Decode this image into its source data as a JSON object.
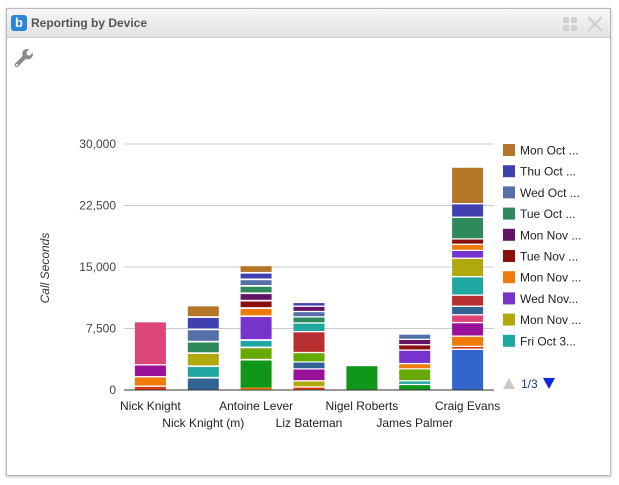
{
  "window": {
    "title": "Reporting by Device",
    "logo_letter": "b"
  },
  "icons": {
    "logo": "bria-logo-icon",
    "layout": "grid-icon",
    "close": "close-icon",
    "settings": "wrench-icon"
  },
  "legend_pager": {
    "text": "1/3",
    "prev": "pager-up-icon",
    "next": "pager-down-icon"
  },
  "chart_data": {
    "type": "bar",
    "stacked": true,
    "ylabel": "Call Seconds",
    "ylim": [
      0,
      30000
    ],
    "yticks": [
      "0",
      "7,500",
      "15,000",
      "22,500",
      "30,000"
    ],
    "ytick_values": [
      0,
      7500,
      15000,
      22500,
      30000
    ],
    "grid": true,
    "legend_position": "right",
    "categories": [
      "Nick Knight",
      "Nick Knight (m)",
      "Antoine Lever",
      "Liz Bateman",
      "Nigel Roberts",
      "James Palmer",
      "Craig Evans"
    ],
    "legend": [
      {
        "label": "Mon Oct ...",
        "color": "#b5762a"
      },
      {
        "label": "Thu Oct ...",
        "color": "#4040b0"
      },
      {
        "label": "Wed Oct ...",
        "color": "#5570a8"
      },
      {
        "label": "Tue Oct ...",
        "color": "#2e8a5c"
      },
      {
        "label": "Mon Nov ...",
        "color": "#641466"
      },
      {
        "label": "Tue Nov ...",
        "color": "#8a1010"
      },
      {
        "label": "Mon Nov ...",
        "color": "#f07a0a"
      },
      {
        "label": "Wed Nov...",
        "color": "#7733cc"
      },
      {
        "label": "Mon Nov ...",
        "color": "#b0a80c"
      },
      {
        "label": "Fri Oct 3...",
        "color": "#20a6a0"
      }
    ],
    "stacks": [
      [
        {
          "v": 400,
          "c": "#dc3912"
        },
        {
          "v": 150,
          "c": "#ffffff"
        },
        {
          "v": 1000,
          "c": "#f07a0a"
        },
        {
          "v": 150,
          "c": "#ffffff"
        },
        {
          "v": 1300,
          "c": "#991199"
        },
        {
          "v": 150,
          "c": "#ffffff"
        },
        {
          "v": 5100,
          "c": "#dd4477"
        }
      ],
      [
        {
          "v": 1400,
          "c": "#316395"
        },
        {
          "v": 200,
          "c": "#ffffff"
        },
        {
          "v": 1200,
          "c": "#20a6a0"
        },
        {
          "v": 200,
          "c": "#ffffff"
        },
        {
          "v": 1400,
          "c": "#b0a80c"
        },
        {
          "v": 200,
          "c": "#ffffff"
        },
        {
          "v": 1200,
          "c": "#2e8a5c"
        },
        {
          "v": 200,
          "c": "#ffffff"
        },
        {
          "v": 1300,
          "c": "#5570a8"
        },
        {
          "v": 200,
          "c": "#ffffff"
        },
        {
          "v": 1300,
          "c": "#4040b0"
        },
        {
          "v": 200,
          "c": "#ffffff"
        },
        {
          "v": 1200,
          "c": "#b5762a"
        }
      ],
      [
        {
          "v": 300,
          "c": "#f07a0a"
        },
        {
          "v": 3300,
          "c": "#109618"
        },
        {
          "v": 200,
          "c": "#ffffff"
        },
        {
          "v": 1300,
          "c": "#66aa00"
        },
        {
          "v": 200,
          "c": "#ffffff"
        },
        {
          "v": 700,
          "c": "#20a6a0"
        },
        {
          "v": 200,
          "c": "#ffffff"
        },
        {
          "v": 2700,
          "c": "#7733cc"
        },
        {
          "v": 200,
          "c": "#ffffff"
        },
        {
          "v": 800,
          "c": "#f07a0a"
        },
        {
          "v": 200,
          "c": "#ffffff"
        },
        {
          "v": 700,
          "c": "#8a1010"
        },
        {
          "v": 200,
          "c": "#ffffff"
        },
        {
          "v": 700,
          "c": "#641466"
        },
        {
          "v": 200,
          "c": "#ffffff"
        },
        {
          "v": 700,
          "c": "#2e8a5c"
        },
        {
          "v": 200,
          "c": "#ffffff"
        },
        {
          "v": 600,
          "c": "#5570a8"
        },
        {
          "v": 200,
          "c": "#ffffff"
        },
        {
          "v": 600,
          "c": "#4040b0"
        },
        {
          "v": 200,
          "c": "#ffffff"
        },
        {
          "v": 700,
          "c": "#b5762a"
        }
      ],
      [
        {
          "v": 300,
          "c": "#dc3912"
        },
        {
          "v": 150,
          "c": "#ffffff"
        },
        {
          "v": 600,
          "c": "#b0a80c"
        },
        {
          "v": 150,
          "c": "#ffffff"
        },
        {
          "v": 1300,
          "c": "#991199"
        },
        {
          "v": 150,
          "c": "#ffffff"
        },
        {
          "v": 700,
          "c": "#316395"
        },
        {
          "v": 150,
          "c": "#ffffff"
        },
        {
          "v": 1000,
          "c": "#66aa00"
        },
        {
          "v": 150,
          "c": "#ffffff"
        },
        {
          "v": 2400,
          "c": "#b82e2e"
        },
        {
          "v": 150,
          "c": "#ffffff"
        },
        {
          "v": 900,
          "c": "#20a6a0"
        },
        {
          "v": 150,
          "c": "#ffffff"
        },
        {
          "v": 600,
          "c": "#2e8a5c"
        },
        {
          "v": 150,
          "c": "#ffffff"
        },
        {
          "v": 500,
          "c": "#5570a8"
        },
        {
          "v": 150,
          "c": "#ffffff"
        },
        {
          "v": 500,
          "c": "#641466"
        },
        {
          "v": 150,
          "c": "#ffffff"
        },
        {
          "v": 300,
          "c": "#4040b0"
        }
      ],
      [
        {
          "v": 2900,
          "c": "#109618"
        }
      ],
      [
        {
          "v": 600,
          "c": "#109618"
        },
        {
          "v": 150,
          "c": "#ffffff"
        },
        {
          "v": 300,
          "c": "#20a6a0"
        },
        {
          "v": 150,
          "c": "#ffffff"
        },
        {
          "v": 1300,
          "c": "#66aa00"
        },
        {
          "v": 150,
          "c": "#ffffff"
        },
        {
          "v": 500,
          "c": "#f07a0a"
        },
        {
          "v": 150,
          "c": "#ffffff"
        },
        {
          "v": 1500,
          "c": "#7733cc"
        },
        {
          "v": 150,
          "c": "#ffffff"
        },
        {
          "v": 500,
          "c": "#8a1010"
        },
        {
          "v": 150,
          "c": "#ffffff"
        },
        {
          "v": 500,
          "c": "#641466"
        },
        {
          "v": 150,
          "c": "#ffffff"
        },
        {
          "v": 500,
          "c": "#5570a8"
        }
      ],
      [
        {
          "v": 4900,
          "c": "#3366cc"
        },
        {
          "v": 150,
          "c": "#ffffff"
        },
        {
          "v": 200,
          "c": "#dc3912"
        },
        {
          "v": 150,
          "c": "#ffffff"
        },
        {
          "v": 1100,
          "c": "#f07a0a"
        },
        {
          "v": 150,
          "c": "#ffffff"
        },
        {
          "v": 1500,
          "c": "#991199"
        },
        {
          "v": 150,
          "c": "#ffffff"
        },
        {
          "v": 800,
          "c": "#dd4477"
        },
        {
          "v": 150,
          "c": "#ffffff"
        },
        {
          "v": 900,
          "c": "#316395"
        },
        {
          "v": 150,
          "c": "#ffffff"
        },
        {
          "v": 1200,
          "c": "#b82e2e"
        },
        {
          "v": 150,
          "c": "#ffffff"
        },
        {
          "v": 2100,
          "c": "#20a6a0"
        },
        {
          "v": 150,
          "c": "#ffffff"
        },
        {
          "v": 2100,
          "c": "#b0a80c"
        },
        {
          "v": 150,
          "c": "#ffffff"
        },
        {
          "v": 800,
          "c": "#7733cc"
        },
        {
          "v": 150,
          "c": "#ffffff"
        },
        {
          "v": 600,
          "c": "#f07a0a"
        },
        {
          "v": 150,
          "c": "#ffffff"
        },
        {
          "v": 500,
          "c": "#8a1010"
        },
        {
          "v": 150,
          "c": "#ffffff"
        },
        {
          "v": 2500,
          "c": "#2e8a5c"
        },
        {
          "v": 150,
          "c": "#ffffff"
        },
        {
          "v": 1500,
          "c": "#4040b0"
        },
        {
          "v": 150,
          "c": "#ffffff"
        },
        {
          "v": 4300,
          "c": "#b5762a"
        }
      ]
    ]
  }
}
